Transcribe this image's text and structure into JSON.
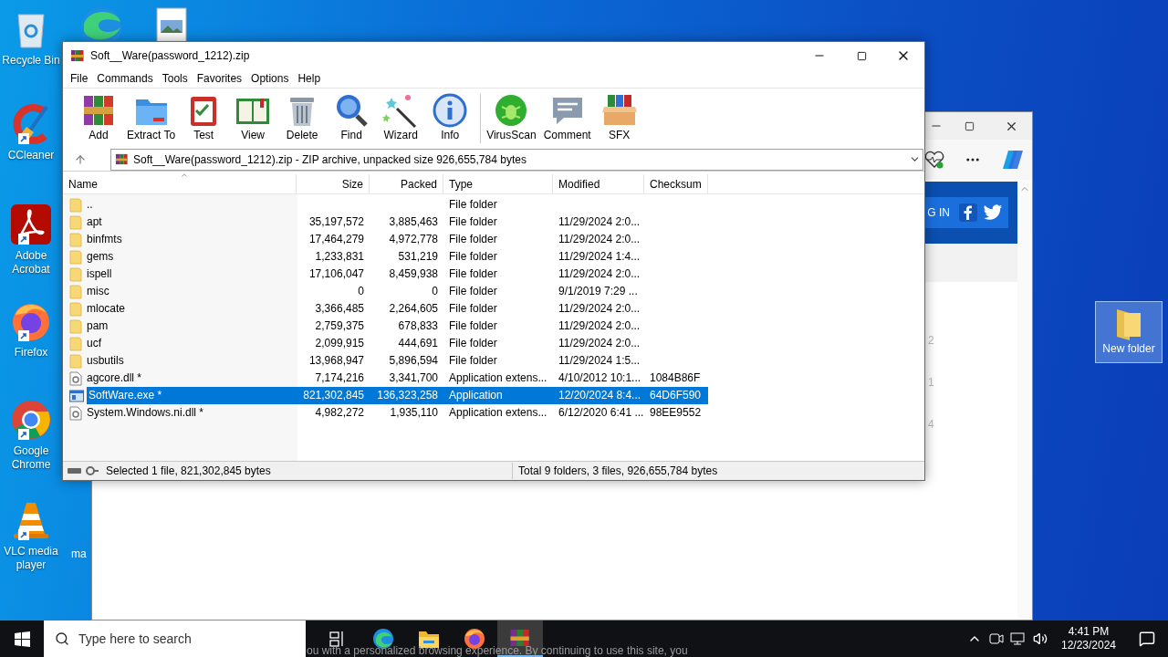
{
  "desktop_icons": [
    {
      "label": "Recycle Bin",
      "kind": "recycle"
    },
    {
      "label": "CCleaner",
      "kind": "ccleaner"
    },
    {
      "label": "Adobe Acrobat",
      "kind": "acrobat"
    },
    {
      "label": "Firefox",
      "kind": "firefox"
    },
    {
      "label": "Google Chrome",
      "kind": "chrome"
    },
    {
      "label": "VLC media player",
      "kind": "vlc"
    }
  ],
  "hidden_icon_label": "ma",
  "new_folder": {
    "label": "New folder",
    "selected": true
  },
  "browser": {
    "login": "G IN",
    "list_numbers": [
      "2",
      "1",
      "4"
    ],
    "footer": "ou with a personalized browsing experience. By continuing to use this site, you"
  },
  "winrar": {
    "title": "Soft__Ware(password_1212).zip",
    "menu": [
      "File",
      "Commands",
      "Tools",
      "Favorites",
      "Options",
      "Help"
    ],
    "toolbar_groups": [
      {
        "buttons": [
          {
            "label": "Add",
            "kind": "add"
          },
          {
            "label": "Extract To",
            "kind": "extract"
          },
          {
            "label": "Test",
            "kind": "test"
          },
          {
            "label": "View",
            "kind": "view"
          },
          {
            "label": "Delete",
            "kind": "delete"
          },
          {
            "label": "Find",
            "kind": "find"
          },
          {
            "label": "Wizard",
            "kind": "wizard"
          },
          {
            "label": "Info",
            "kind": "info"
          }
        ]
      },
      {
        "buttons": [
          {
            "label": "VirusScan",
            "kind": "virusscan"
          },
          {
            "label": "Comment",
            "kind": "comment"
          },
          {
            "label": "SFX",
            "kind": "sfx"
          }
        ]
      }
    ],
    "address": "Soft__Ware(password_1212).zip - ZIP archive, unpacked size 926,655,784 bytes",
    "columns": [
      {
        "label": "Name",
        "sorted": true
      },
      {
        "label": "Size",
        "sorted": false
      },
      {
        "label": "Packed",
        "sorted": false
      },
      {
        "label": "Type",
        "sorted": false
      },
      {
        "label": "Modified",
        "sorted": false
      },
      {
        "label": "Checksum",
        "sorted": false
      }
    ],
    "rows": [
      {
        "kind": "folder",
        "selected": false,
        "name": "..",
        "size": "",
        "packed": "",
        "type": "File folder",
        "modified": "",
        "checksum": ""
      },
      {
        "kind": "folder",
        "selected": false,
        "name": "apt",
        "size": "35,197,572",
        "packed": "3,885,463",
        "type": "File folder",
        "modified": "11/29/2024 2:0...",
        "checksum": ""
      },
      {
        "kind": "folder",
        "selected": false,
        "name": "binfmts",
        "size": "17,464,279",
        "packed": "4,972,778",
        "type": "File folder",
        "modified": "11/29/2024 2:0...",
        "checksum": ""
      },
      {
        "kind": "folder",
        "selected": false,
        "name": "gems",
        "size": "1,233,831",
        "packed": "531,219",
        "type": "File folder",
        "modified": "11/29/2024 1:4...",
        "checksum": ""
      },
      {
        "kind": "folder",
        "selected": false,
        "name": "ispell",
        "size": "17,106,047",
        "packed": "8,459,938",
        "type": "File folder",
        "modified": "11/29/2024 2:0...",
        "checksum": ""
      },
      {
        "kind": "folder",
        "selected": false,
        "name": "misc",
        "size": "0",
        "packed": "0",
        "type": "File folder",
        "modified": "9/1/2019 7:29 ...",
        "checksum": ""
      },
      {
        "kind": "folder",
        "selected": false,
        "name": "mlocate",
        "size": "3,366,485",
        "packed": "2,264,605",
        "type": "File folder",
        "modified": "11/29/2024 2:0...",
        "checksum": ""
      },
      {
        "kind": "folder",
        "selected": false,
        "name": "pam",
        "size": "2,759,375",
        "packed": "678,833",
        "type": "File folder",
        "modified": "11/29/2024 2:0...",
        "checksum": ""
      },
      {
        "kind": "folder",
        "selected": false,
        "name": "ucf",
        "size": "2,099,915",
        "packed": "444,691",
        "type": "File folder",
        "modified": "11/29/2024 2:0...",
        "checksum": ""
      },
      {
        "kind": "folder",
        "selected": false,
        "name": "usbutils",
        "size": "13,968,947",
        "packed": "5,896,594",
        "type": "File folder",
        "modified": "11/29/2024 1:5...",
        "checksum": ""
      },
      {
        "kind": "dll",
        "selected": false,
        "name": "agcore.dll *",
        "size": "7,174,216",
        "packed": "3,341,700",
        "type": "Application extens...",
        "modified": "4/10/2012 10:1...",
        "checksum": "1084B86F"
      },
      {
        "kind": "exe",
        "selected": true,
        "name": "SoftWare.exe *",
        "size": "821,302,845",
        "packed": "136,323,258",
        "type": "Application",
        "modified": "12/20/2024 8:4...",
        "checksum": "64D6F590"
      },
      {
        "kind": "dll",
        "selected": false,
        "name": "System.Windows.ni.dll *",
        "size": "4,982,272",
        "packed": "1,935,110",
        "type": "Application extens...",
        "modified": "6/12/2020 6:41 ...",
        "checksum": "98EE9552"
      }
    ],
    "status_left": "Selected 1 file, 821,302,845 bytes",
    "status_right": "Total 9 folders, 3 files, 926,655,784 bytes"
  },
  "taskbar": {
    "search_placeholder": "Type here to search",
    "apps": [
      {
        "kind": "taskview",
        "active": false
      },
      {
        "kind": "edge",
        "active": false
      },
      {
        "kind": "explorer",
        "active": false
      },
      {
        "kind": "firefox",
        "active": false
      },
      {
        "kind": "winrar",
        "active": true
      }
    ],
    "time": "4:41 PM",
    "date": "12/23/2024"
  }
}
